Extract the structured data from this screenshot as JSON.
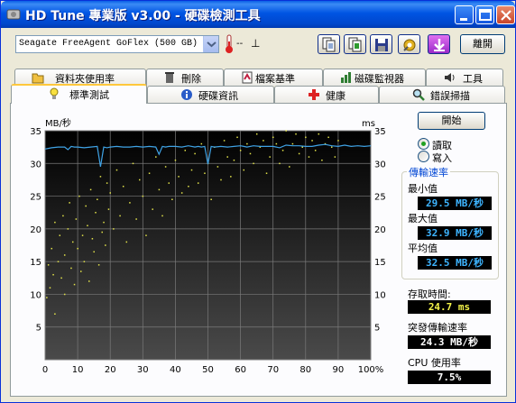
{
  "window": {
    "title": "HD Tune 專業版 v3.00 - 硬碟檢測工具"
  },
  "toolbar": {
    "drive": "Seagate FreeAgent GoFlex (500 GB)",
    "temperature": "--",
    "temperature_unit": "⊥",
    "exit_label": "離開",
    "tools": [
      "copy-text-icon",
      "copy-screen-icon",
      "save-icon",
      "options-icon",
      "download-icon"
    ]
  },
  "tabs_top": [
    {
      "label": "資料夾使用率",
      "icon": "folder-icon"
    },
    {
      "label": "刪除",
      "icon": "trash-icon"
    },
    {
      "label": "檔案基準",
      "icon": "file-benchmark-icon"
    },
    {
      "label": "磁碟監視器",
      "icon": "disk-monitor-icon"
    },
    {
      "label": "工具",
      "icon": "speaker-icon"
    }
  ],
  "tabs_bottom": [
    {
      "label": "標準測試",
      "icon": "benchmark-icon",
      "active": true
    },
    {
      "label": "硬碟資訊",
      "icon": "info-icon",
      "active": false
    },
    {
      "label": "健康",
      "icon": "health-cross-icon",
      "active": false
    },
    {
      "label": "錯誤掃描",
      "icon": "magnifier-icon",
      "active": false
    }
  ],
  "controls": {
    "start_label": "開始",
    "read_label": "讀取",
    "write_label": "寫入",
    "mode_selected": "read"
  },
  "results": {
    "transfer_title": "傳輸速率",
    "min_label": "最小值",
    "min_value": "29.5 MB/秒",
    "max_label": "最大值",
    "max_value": "32.9 MB/秒",
    "avg_label": "平均值",
    "avg_value": "32.5 MB/秒",
    "access_label": "存取時間:",
    "access_value": "24.7 ms",
    "burst_label": "突發傳輸速率",
    "burst_value": "24.3 MB/秒",
    "cpu_label": "CPU 使用率",
    "cpu_value": "7.5%"
  },
  "colors": {
    "transfer_line": "#3FA3E6",
    "access_dots": "#E3E34A",
    "plot_bg_top": "#000000",
    "plot_bg_bottom": "#4A4A4A",
    "grid": "#7A7A7A"
  },
  "chart_data": {
    "type": "line",
    "ylabel_left": "MB/秒",
    "ylabel_right": "ms",
    "xlim": [
      0,
      100
    ],
    "ylim": [
      0,
      35
    ],
    "y2lim": [
      0,
      35
    ],
    "x_ticks": [
      "0",
      "10",
      "20",
      "30",
      "40",
      "50",
      "60",
      "70",
      "80",
      "90",
      "100%"
    ],
    "y_ticks": [
      "5",
      "10",
      "15",
      "20",
      "25",
      "30",
      "35"
    ],
    "y2_ticks": [
      "5",
      "10",
      "15",
      "20",
      "25",
      "30",
      "35"
    ],
    "series": [
      {
        "kind": "line",
        "x": [
          0,
          2,
          4,
          6,
          7,
          8,
          9,
          10,
          12,
          14,
          16,
          17,
          18,
          19,
          20,
          22,
          24,
          26,
          28,
          30,
          32,
          34,
          35,
          36,
          37,
          38,
          40,
          42,
          44,
          46,
          47,
          48,
          49,
          50,
          51,
          52,
          54,
          56,
          58,
          60,
          61,
          62,
          64,
          66,
          68,
          70,
          71,
          72,
          74,
          76,
          78,
          80,
          82,
          84,
          86,
          88,
          90,
          92,
          94,
          96,
          98,
          100
        ],
        "y": [
          32.2,
          32.4,
          32.5,
          32.5,
          32.1,
          32.6,
          32.5,
          32.5,
          32.4,
          32.5,
          32.6,
          29.5,
          32.5,
          32.4,
          32.5,
          32.6,
          32.5,
          32.5,
          32.6,
          32.5,
          32.6,
          32.5,
          31.4,
          32.6,
          32.5,
          32.6,
          32.6,
          32.5,
          32.7,
          32.5,
          32.6,
          32.5,
          32.6,
          29.9,
          32.6,
          32.5,
          32.6,
          32.5,
          32.6,
          32.7,
          32.6,
          32.5,
          32.7,
          32.6,
          32.6,
          32.6,
          32.5,
          32.4,
          32.8,
          32.7,
          32.7,
          32.6,
          32.6,
          32.8,
          32.9,
          32.7,
          32.6,
          32.8,
          32.6,
          32.7,
          32.6,
          32.7
        ]
      },
      {
        "kind": "scatter",
        "x": [
          0.5,
          1,
          1.5,
          2,
          2.5,
          3,
          3,
          4,
          4.5,
          5,
          5.5,
          6,
          6,
          7,
          7.5,
          8,
          8.5,
          9,
          9.5,
          10,
          10.5,
          11,
          11.5,
          12,
          12.5,
          13,
          13.5,
          14,
          14.5,
          15,
          15.5,
          16,
          16.5,
          17,
          17.5,
          18,
          18.5,
          19,
          19.5,
          20,
          21,
          22,
          23,
          24,
          25,
          26,
          27,
          28,
          29,
          30,
          31,
          32,
          33,
          34,
          35,
          36,
          37,
          38,
          39,
          40,
          41,
          42,
          43,
          44,
          45,
          46,
          47,
          48,
          49,
          50,
          51,
          52,
          53,
          54,
          55,
          56,
          57,
          58,
          59,
          60,
          61,
          62,
          63,
          64,
          65,
          66,
          67,
          68,
          69,
          70,
          71,
          72,
          73,
          74,
          75,
          76,
          77,
          78,
          79,
          80,
          81,
          82,
          83,
          84,
          85,
          86,
          87,
          88,
          89,
          90
        ],
        "y": [
          9.5,
          14.5,
          11,
          17,
          13,
          21,
          7,
          15,
          19,
          12.5,
          22,
          16,
          10,
          20,
          24,
          14,
          18,
          11.5,
          21.5,
          17,
          25,
          13.5,
          19,
          15,
          23.5,
          20.5,
          12,
          26,
          18.5,
          16.5,
          22.5,
          24.5,
          14.5,
          28,
          19.5,
          21,
          17.5,
          27,
          23,
          25.5,
          20,
          29,
          22,
          26.5,
          18,
          24,
          30,
          21.5,
          27.5,
          25,
          19,
          28.5,
          23,
          31,
          26,
          22,
          29.5,
          27,
          24.5,
          30.5,
          28,
          25.5,
          32,
          26.5,
          29,
          31.5,
          27,
          33,
          28.5,
          30,
          24.5,
          32.5,
          29.5,
          27.5,
          33.5,
          31,
          28,
          30.5,
          34,
          32,
          29,
          33,
          31.5,
          30,
          34.5,
          32.5,
          33.5,
          28.5,
          31,
          34,
          33,
          30,
          32,
          35,
          29.5,
          33,
          34.5,
          31.5,
          32.5,
          34,
          31,
          33.5,
          32,
          34.5,
          30.5,
          33,
          34,
          32.5,
          31,
          33.5
        ]
      }
    ]
  }
}
